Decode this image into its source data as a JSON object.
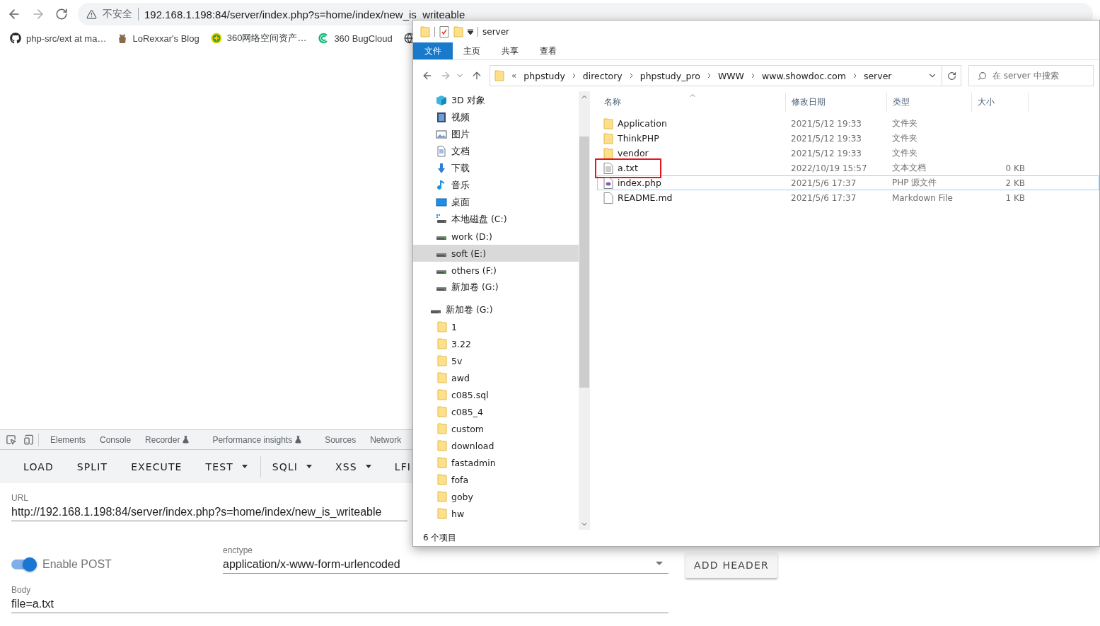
{
  "browser": {
    "forward_disabled": true,
    "address_bar": {
      "security": "不安全",
      "url": "192.168.1.198:84/server/index.php?s=home/index/new_is_writeable"
    },
    "bookmarks": [
      {
        "label": "php-src/ext at ma…",
        "kind": "github"
      },
      {
        "label": "LoRexxar's Blog",
        "kind": "figure"
      },
      {
        "label": "360网络空间资产…",
        "kind": "plus-circle"
      },
      {
        "label": "360 BugCloud",
        "kind": "c-mark"
      },
      {
        "kind": "globe"
      }
    ]
  },
  "devtools": {
    "tabs": [
      {
        "label": "Elements",
        "experimental": false
      },
      {
        "label": "Console",
        "experimental": false
      },
      {
        "label": "Recorder",
        "experimental": true
      },
      {
        "label": "Performance insights",
        "experimental": true
      },
      {
        "label": "Sources",
        "experimental": false
      },
      {
        "label": "Network",
        "experimental": false
      }
    ]
  },
  "hackbar": {
    "buttons": [
      {
        "label": "LOAD",
        "dropdown": false,
        "separator_before": false
      },
      {
        "label": "SPLIT",
        "dropdown": false,
        "separator_before": false
      },
      {
        "label": "EXECUTE",
        "dropdown": false,
        "separator_before": false
      },
      {
        "label": "TEST",
        "dropdown": true,
        "separator_before": false
      },
      {
        "label": "SQLI",
        "dropdown": true,
        "separator_before": true
      },
      {
        "label": "XSS",
        "dropdown": true,
        "separator_before": false
      },
      {
        "label": "LFI",
        "dropdown": false,
        "separator_before": false
      }
    ],
    "url": {
      "label": "URL",
      "value": "http://192.168.1.198:84/server/index.php?s=home/index/new_is_writeable"
    },
    "post": {
      "label": "Enable POST",
      "on": true
    },
    "enctype": {
      "label": "enctype",
      "value": "application/x-www-form-urlencoded"
    },
    "add_header": "ADD HEADER",
    "body": {
      "label": "Body",
      "value": "file=a.txt"
    }
  },
  "explorer": {
    "title": "server",
    "forward_disabled": true,
    "ribbon_tabs": [
      {
        "label": "文件",
        "selected": true
      },
      {
        "label": "主页",
        "selected": false
      },
      {
        "label": "共享",
        "selected": false
      },
      {
        "label": "查看",
        "selected": false
      }
    ],
    "overflow_mark": "«",
    "breadcrumb": [
      "phpstudy",
      "directory",
      "phpstudy_pro",
      "WWW",
      "www.showdoc.com",
      "server"
    ],
    "search": {
      "placeholder": "在 server 中搜索"
    },
    "nav": {
      "items": [
        {
          "label": "3D 对象",
          "kind": "cube",
          "selected": false
        },
        {
          "label": "视频",
          "kind": "video",
          "selected": false
        },
        {
          "label": "图片",
          "kind": "image",
          "selected": false
        },
        {
          "label": "文档",
          "kind": "document",
          "selected": false
        },
        {
          "label": "下载",
          "kind": "download",
          "selected": false
        },
        {
          "label": "音乐",
          "kind": "music",
          "selected": false
        },
        {
          "label": "桌面",
          "kind": "desktop",
          "selected": false
        },
        {
          "label": "本地磁盘 (C:)",
          "kind": "system-drive",
          "selected": false
        },
        {
          "label": "work (D:)",
          "kind": "drive",
          "selected": false
        },
        {
          "label": "soft (E:)",
          "kind": "drive",
          "selected": true
        },
        {
          "label": "others (F:)",
          "kind": "drive",
          "selected": false
        },
        {
          "label": "新加卷 (G:)",
          "kind": "drive",
          "selected": false
        }
      ],
      "drive": {
        "label": "新加卷 (G:)",
        "kind": "drive",
        "selected": false,
        "children": [
          {
            "label": "1",
            "kind": "folder",
            "selected": false
          },
          {
            "label": "3.22",
            "kind": "folder",
            "selected": false
          },
          {
            "label": "5v",
            "kind": "folder",
            "selected": false
          },
          {
            "label": "awd",
            "kind": "folder",
            "selected": false
          },
          {
            "label": "c085.sql",
            "kind": "folder",
            "selected": false
          },
          {
            "label": "c085_4",
            "kind": "folder",
            "selected": false
          },
          {
            "label": "custom",
            "kind": "folder",
            "selected": false
          },
          {
            "label": "download",
            "kind": "folder",
            "selected": false
          },
          {
            "label": "fastadmin",
            "kind": "folder",
            "selected": false
          },
          {
            "label": "fofa",
            "kind": "folder",
            "selected": false
          },
          {
            "label": "goby",
            "kind": "folder",
            "selected": false
          },
          {
            "label": "hw",
            "kind": "folder",
            "selected": false
          }
        ]
      }
    },
    "columns": [
      "名称",
      "修改日期",
      "类型",
      "大小"
    ],
    "files": [
      {
        "name": "Application",
        "date": "2021/5/12 19:33",
        "type": "文件夹",
        "kind": "folder",
        "selected": false,
        "highlighted": false
      },
      {
        "name": "ThinkPHP",
        "date": "2021/5/12 19:33",
        "type": "文件夹",
        "kind": "folder",
        "selected": false,
        "highlighted": false
      },
      {
        "name": "vendor",
        "date": "2021/5/12 19:33",
        "type": "文件夹",
        "kind": "folder",
        "selected": false,
        "highlighted": false
      },
      {
        "name": "a.txt",
        "date": "2022/10/19 15:57",
        "type": "文本文档",
        "size": "0 KB",
        "kind": "text",
        "selected": false,
        "highlighted": true
      },
      {
        "name": "index.php",
        "date": "2021/5/6 17:37",
        "type": "PHP 源文件",
        "size": "2 KB",
        "kind": "php",
        "selected": true,
        "highlighted": false
      },
      {
        "name": "README.md",
        "date": "2021/5/6 17:37",
        "type": "Markdown File",
        "size": "1 KB",
        "kind": "blank",
        "selected": false,
        "highlighted": false
      }
    ],
    "status": "6 个项目"
  }
}
